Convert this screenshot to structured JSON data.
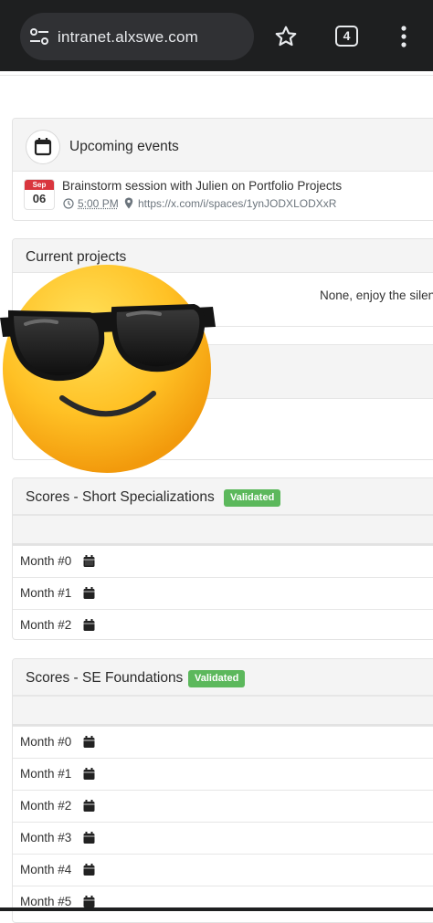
{
  "browser": {
    "url": "intranet.alxswe.com",
    "tab_count": "4"
  },
  "events": {
    "title": "Upcoming events",
    "item": {
      "month": "Sep",
      "day": "06",
      "title": "Brainstorm session with Julien on Portfolio Projects",
      "time": "5:00 PM",
      "link": "https://x.com/i/spaces/1ynJODXLODXxR"
    }
  },
  "projects": {
    "title": "Current projects",
    "empty_text": "None, enjoy the silence"
  },
  "short_spec": {
    "title": "Scores - Short Specializations",
    "badge": "Validated",
    "months": [
      "Month #0",
      "Month #1",
      "Month #2"
    ]
  },
  "se_foundations": {
    "title": "Scores - SE Foundations",
    "badge": "Validated",
    "months": [
      "Month #0",
      "Month #1",
      "Month #2",
      "Month #3",
      "Month #4",
      "Month #5"
    ]
  },
  "colors": {
    "badge": "#5cb85c",
    "date_header": "#d9363e",
    "chrome": "#1e1f20"
  },
  "overlay": {
    "sticker": "sunglasses-emoji"
  }
}
